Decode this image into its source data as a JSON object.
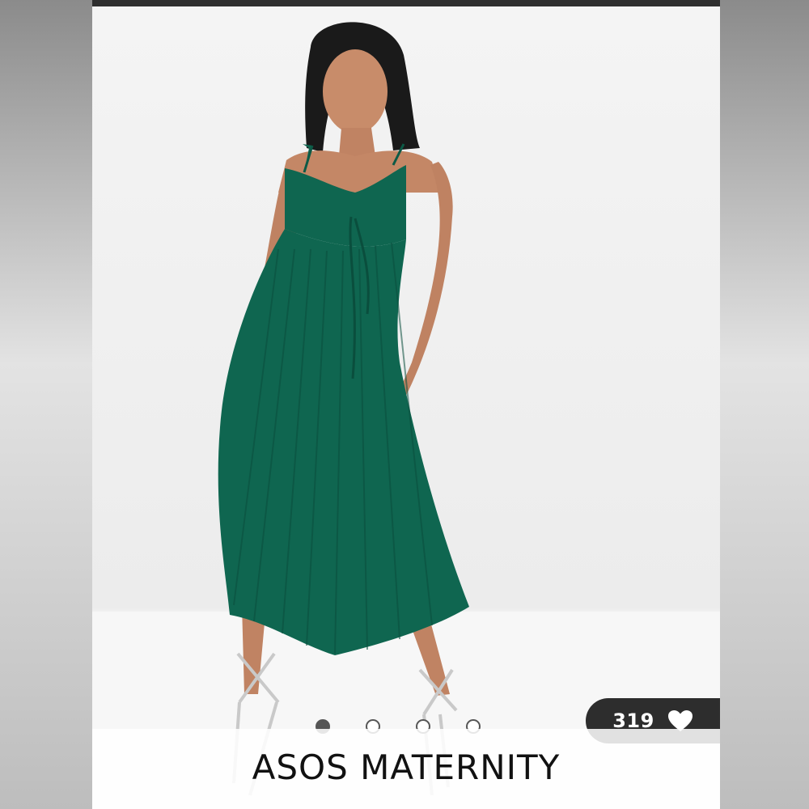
{
  "listing": {
    "brand": "ASOS MATERNITY",
    "like_count": "319",
    "like_icon": "heart-icon",
    "photo_count": 4,
    "active_photo_index": 0
  },
  "colors": {
    "dress": "#0f6650",
    "like_badge": "#2d2d2d",
    "backdrop": "#f1f1f1"
  }
}
